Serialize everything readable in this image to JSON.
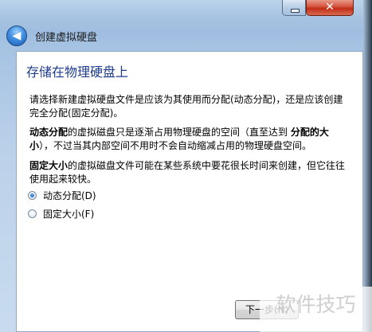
{
  "window": {
    "title": "创建虚拟硬盘",
    "close_glyph": "✕"
  },
  "page": {
    "heading": "存储在物理硬盘上",
    "paragraph1": "请选择新建虚拟硬盘文件是应该为其使用而分配(动态分配)，还是应该创建完全分配(固定分配)。",
    "paragraph2_bold1": "动态分配",
    "paragraph2_text1": "的虚拟磁盘只是逐渐占用物理硬盘的空间（直至达到 ",
    "paragraph2_bold2": "分配的大小",
    "paragraph2_text2": "），不过当其内部空间不用时不会自动缩减占用的物理硬盘空间。",
    "paragraph3_bold": "固定大小",
    "paragraph3_text": "的虚拟磁盘文件可能在某些系统中要花很长时间来创建，但它往往使用起来较快。"
  },
  "options": [
    {
      "label": "动态分配(D)",
      "checked": true
    },
    {
      "label": "固定大小(F)",
      "checked": false
    }
  ],
  "buttons": {
    "next_label": "下一步(N)"
  },
  "watermark": "软件技巧",
  "colors": {
    "heading": "#1e3c8c",
    "close_button": "#c12d16"
  },
  "icons": {
    "back": "back-arrow-icon",
    "close": "close-icon"
  }
}
